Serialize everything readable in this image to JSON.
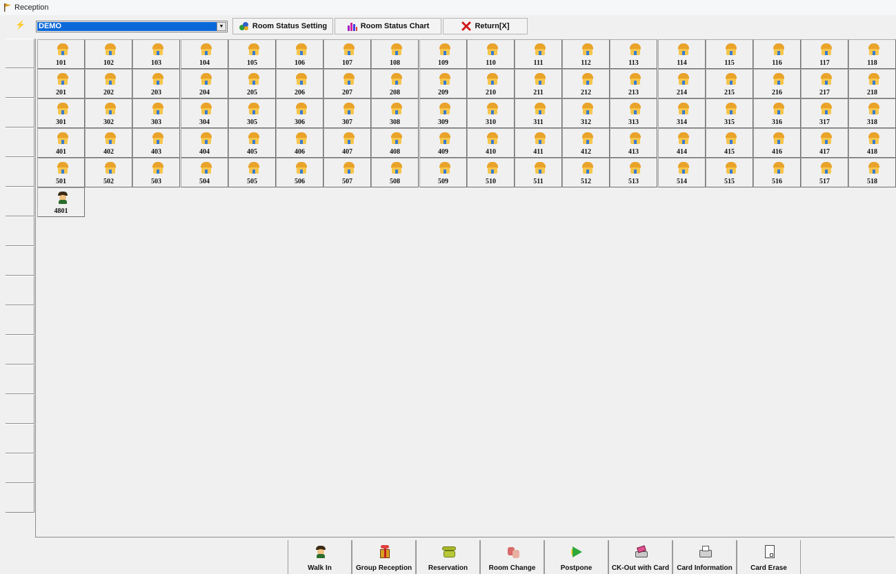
{
  "window": {
    "title": "Reception"
  },
  "toolbar": {
    "building_select": {
      "value": "DEMO"
    },
    "room_status_setting": "Room Status Setting",
    "room_status_chart": "Room Status Chart",
    "return": "Return[X]"
  },
  "floors": [
    {
      "rooms": [
        "101",
        "102",
        "103",
        "104",
        "105",
        "106",
        "107",
        "108",
        "109",
        "110",
        "111",
        "112",
        "113",
        "114",
        "115",
        "116",
        "117",
        "118"
      ],
      "status": "vacant"
    },
    {
      "rooms": [
        "201",
        "202",
        "203",
        "204",
        "205",
        "206",
        "207",
        "208",
        "209",
        "210",
        "211",
        "212",
        "213",
        "214",
        "215",
        "216",
        "217",
        "218"
      ],
      "status": "vacant"
    },
    {
      "rooms": [
        "301",
        "302",
        "303",
        "304",
        "305",
        "306",
        "307",
        "308",
        "309",
        "310",
        "311",
        "312",
        "313",
        "314",
        "315",
        "316",
        "317",
        "318"
      ],
      "status": "vacant"
    },
    {
      "rooms": [
        "401",
        "402",
        "403",
        "404",
        "405",
        "406",
        "407",
        "408",
        "409",
        "410",
        "411",
        "412",
        "413",
        "414",
        "415",
        "416",
        "417",
        "418"
      ],
      "status": "vacant"
    },
    {
      "rooms": [
        "501",
        "502",
        "503",
        "504",
        "505",
        "506",
        "507",
        "508",
        "509",
        "510",
        "511",
        "512",
        "513",
        "514",
        "515",
        "516",
        "517",
        "518"
      ],
      "status": "vacant"
    },
    {
      "rooms": [
        "4801"
      ],
      "status": "occupied"
    }
  ],
  "actions": [
    {
      "label": "Walk In",
      "icon": "walk-in-icon"
    },
    {
      "label": "Group Reception",
      "icon": "gift-icon"
    },
    {
      "label": "Reservation",
      "icon": "phone-icon"
    },
    {
      "label": "Room Change",
      "icon": "room-change-icon"
    },
    {
      "label": "Postpone",
      "icon": "arrow-right-icon"
    },
    {
      "label": "CK-Out with Card",
      "icon": "card-reader-icon"
    },
    {
      "label": "Card Information",
      "icon": "card-info-icon"
    },
    {
      "label": "Card Erase",
      "icon": "card-erase-icon"
    }
  ],
  "colors": {
    "selection": "#0a68d8",
    "vacant_room": "#f6c64c",
    "occupied_room": "#3b2a15"
  }
}
